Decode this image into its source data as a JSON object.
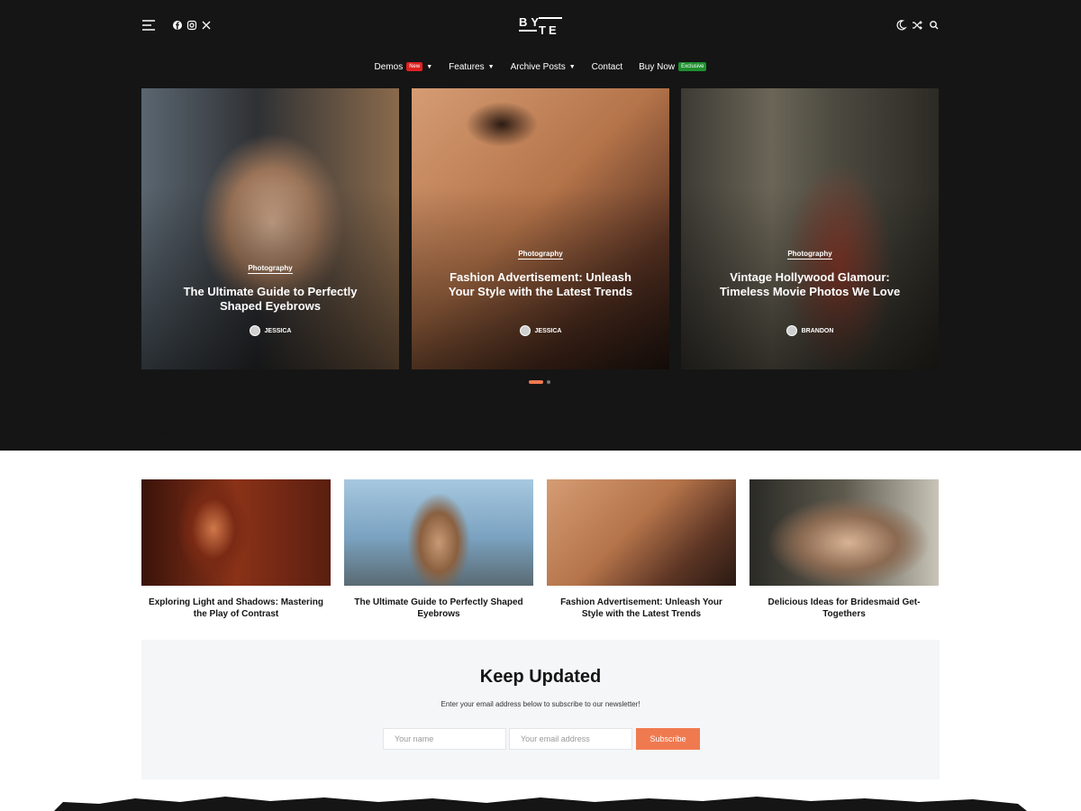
{
  "brand": {
    "logo_top": "BY",
    "logo_bottom": "TE"
  },
  "topbar": {
    "left_icons": [
      "menu-icon",
      "facebook-icon",
      "instagram-icon",
      "x-icon"
    ],
    "right_icons": [
      "moon-icon",
      "shuffle-icon",
      "search-icon"
    ]
  },
  "nav": {
    "items": [
      {
        "label": "Demos",
        "badge": "New",
        "dropdown": true
      },
      {
        "label": "Features",
        "dropdown": true
      },
      {
        "label": "Archive Posts",
        "dropdown": true
      },
      {
        "label": "Contact"
      },
      {
        "label": "Buy Now",
        "badge": "Exclusive"
      }
    ]
  },
  "hero": [
    {
      "category": "Photography",
      "title": "The Ultimate Guide to Perfectly Shaped Eyebrows",
      "author": "JESSICA"
    },
    {
      "category": "Photography",
      "title": "Fashion Advertisement: Unleash Your Style with the Latest Trends",
      "author": "JESSICA"
    },
    {
      "category": "Photography",
      "title": "Vintage Hollywood Glamour: Timeless Movie Photos We Love",
      "author": "BRANDON"
    }
  ],
  "slider": {
    "active_index": 0,
    "count": 2
  },
  "posts": [
    {
      "title": "Exploring Light and Shadows: Mastering the Play of Contrast"
    },
    {
      "title": "The Ultimate Guide to Perfectly Shaped Eyebrows"
    },
    {
      "title": "Fashion Advertisement: Unleash Your Style with the Latest Trends"
    },
    {
      "title": "Delicious Ideas for Bridesmaid Get-Togethers"
    }
  ],
  "newsletter": {
    "heading": "Keep Updated",
    "text": "Enter your email address below to subscribe to our newsletter!",
    "name_placeholder": "Your name",
    "email_placeholder": "Your email address",
    "button": "Subscribe"
  },
  "colors": {
    "dark_bg": "#151515",
    "accent": "#f07a50",
    "new_badge": "#e02020",
    "exclusive_badge": "#1f8f2f",
    "newsletter_bg": "#f5f6f8"
  }
}
